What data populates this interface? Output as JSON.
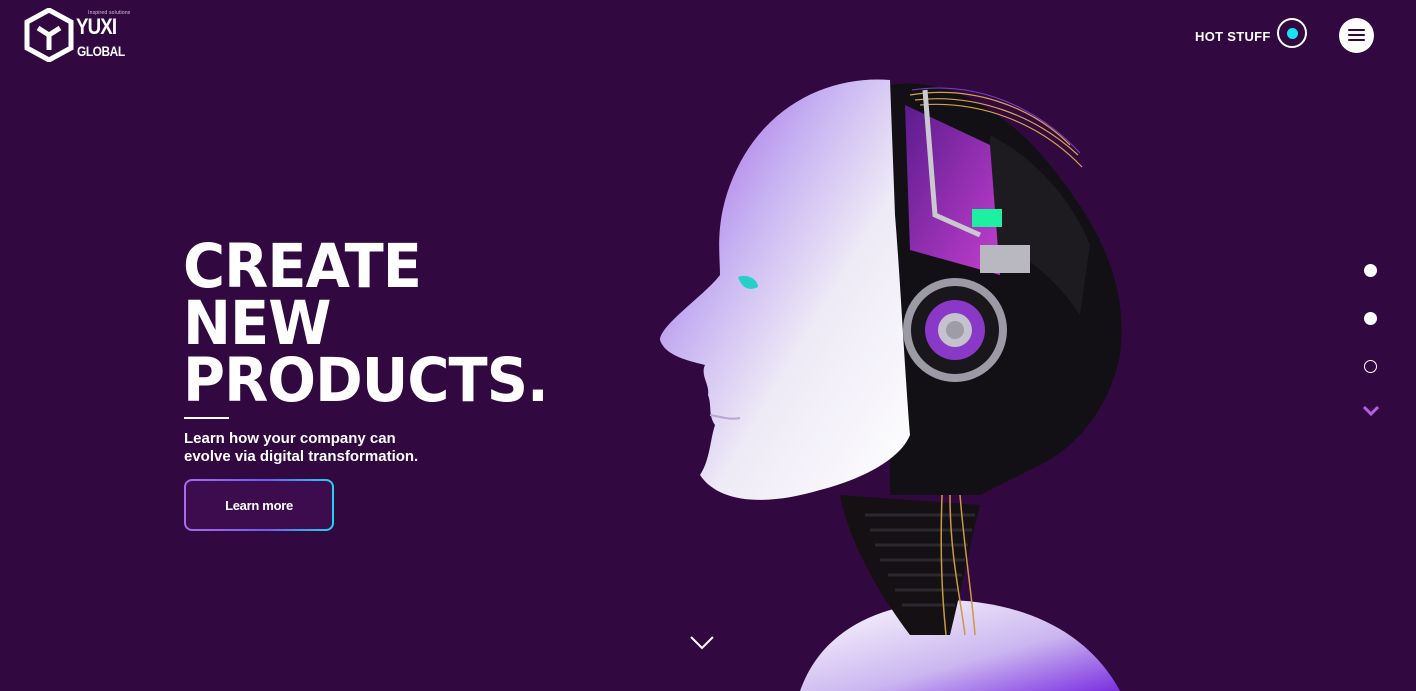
{
  "logo": {
    "tagline": "Inspired solutions",
    "word1": "YUXI",
    "word2": "GLOBAL"
  },
  "header": {
    "hot_stuff_label": "HOT STUFF",
    "hot_dot_icon": "record-icon",
    "menu_icon": "hamburger-icon"
  },
  "hero": {
    "headline": "CREATE\nNEW\nPRODUCTS.",
    "subtext": "Learn how your company can evolve via digital transformation.",
    "cta_label": "Learn more",
    "image": "robot-head-illustration"
  },
  "section_nav": {
    "dots": [
      {
        "state": "filled"
      },
      {
        "state": "filled"
      },
      {
        "state": "empty"
      }
    ],
    "chevron_icon": "chevron-down-icon"
  },
  "colors": {
    "background": "#320840",
    "accent_cyan": "#19e3f0",
    "accent_purple": "#a86cf0",
    "chevron_purple": "#b45ee0"
  }
}
